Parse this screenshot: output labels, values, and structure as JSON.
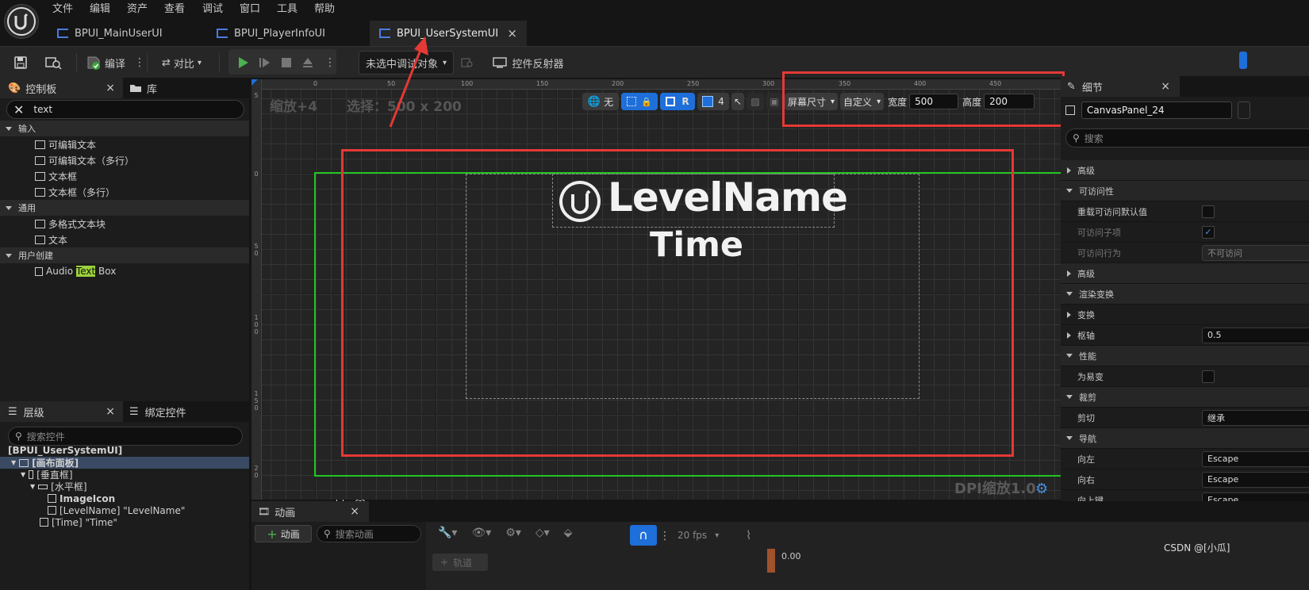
{
  "menu": [
    "文件",
    "编辑",
    "资产",
    "查看",
    "调试",
    "窗口",
    "工具",
    "帮助"
  ],
  "tabs": [
    {
      "label": "BPUI_MainUserUI",
      "active": false
    },
    {
      "label": "BPUI_PlayerInfoUI",
      "active": false
    },
    {
      "label": "BPUI_UserSystemUI",
      "active": true
    }
  ],
  "close_glyph": "×",
  "toolbar": {
    "compile_label": "编译",
    "diff_label": "对比",
    "debug_object": "未选中调试对象",
    "widget_reflector": "控件反射器"
  },
  "palette": {
    "title": "控制板",
    "library": "库",
    "search_value": "text",
    "categories": [
      {
        "name": "输入",
        "items": [
          "可编辑文本",
          "可编辑文本（多行）",
          "文本框",
          "文本框（多行）"
        ]
      },
      {
        "name": "通用",
        "items": [
          "多格式文本块",
          "文本"
        ]
      },
      {
        "name": "用户创建",
        "items": []
      }
    ],
    "user_item": {
      "pre": "Audio ",
      "highlight": "Text",
      "post": " Box"
    }
  },
  "hierarchy": {
    "title": "层级",
    "bind_tab": "绑定控件",
    "search_placeholder": "搜索控件",
    "root": "[BPUI_UserSystemUI]",
    "nodes": [
      {
        "label": "[画布面板]",
        "selected": true
      },
      {
        "label": "[垂直框]",
        "selected": false
      },
      {
        "label": "[水平框]",
        "selected": false
      },
      {
        "label": "ImageIcon",
        "selected": false
      },
      {
        "label": "[LevelName] \"LevelName\"",
        "selected": false
      },
      {
        "label": "[Time] \"Time\"",
        "selected": false
      }
    ]
  },
  "designer": {
    "zoom": "缩放+4",
    "selection": "选择：500 x 200",
    "ruler_labels": [
      "0",
      "50",
      "100",
      "150",
      "200",
      "250",
      "300",
      "350",
      "400",
      "450"
    ],
    "vruler_labels": [
      "5",
      "0",
      "5\n0",
      "1\n0\n0",
      "1\n5\n0",
      "2\n0"
    ],
    "none_label": "无",
    "r_label": "R",
    "grid_value": "4",
    "screen_size": "屏幕尺寸",
    "custom": "自定义",
    "width_label": "宽度",
    "width_value": "500",
    "height_label": "高度",
    "height_value": "200",
    "level_name": "LevelName",
    "time_text": "Time",
    "dpi": "DPI缩放1.0"
  },
  "details": {
    "title": "细节",
    "widget_name": "CanvasPanel_24",
    "search_placeholder": "搜索",
    "rows": [
      {
        "type": "collapsed",
        "label": "高级"
      },
      {
        "type": "section",
        "label": "可访问性"
      },
      {
        "type": "check",
        "label": "重载可访问默认值",
        "checked": false
      },
      {
        "type": "check",
        "label": "可访问子项",
        "checked": true,
        "dim": true
      },
      {
        "type": "value",
        "label": "可访问行为",
        "value": "不可访问",
        "dim": true
      },
      {
        "type": "collapsed",
        "label": "高级"
      },
      {
        "type": "section",
        "label": "渲染变换"
      },
      {
        "type": "collapsed",
        "label": "变换"
      },
      {
        "type": "collapsedval",
        "label": "枢轴",
        "value": "0.5"
      },
      {
        "type": "section",
        "label": "性能"
      },
      {
        "type": "check",
        "label": "为易变",
        "checked": false
      },
      {
        "type": "section",
        "label": "裁剪"
      },
      {
        "type": "value",
        "label": "剪切",
        "value": "继承"
      },
      {
        "type": "section",
        "label": "导航"
      },
      {
        "type": "value",
        "label": "向左",
        "value": "Escape"
      },
      {
        "type": "value",
        "label": "向右",
        "value": "Escape"
      },
      {
        "type": "value",
        "label": "向上键",
        "value": "Escape"
      }
    ]
  },
  "animation": {
    "title": "动画",
    "add_label": "动画",
    "search_placeholder": "搜索动画",
    "fps": "20 fps",
    "track_label": "轨道",
    "time_value": "0.00"
  },
  "watermark": "CSDN @[小瓜]",
  "colors": {
    "annotation_red": "#e53935",
    "green_frame": "#22c522",
    "accent_blue": "#1e6fd9"
  }
}
